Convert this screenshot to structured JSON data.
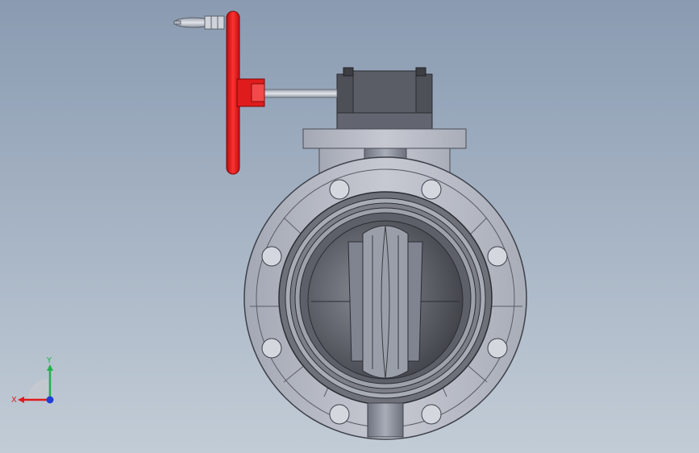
{
  "viewport": {
    "background_top": "#8a9bb1",
    "background_bottom": "#c2ccd6"
  },
  "model": {
    "part": "butterfly-valve",
    "handwheel_color": "#e01b1b",
    "body_color": "#b9bcc6",
    "gearbox_color": "#5a5d66",
    "disc_color": "#5e6069"
  },
  "triad": {
    "x_label": "X",
    "y_label": "Y",
    "x_color": "#e01b1b",
    "y_color": "#22b14c",
    "z_color": "#1f3fd6"
  }
}
